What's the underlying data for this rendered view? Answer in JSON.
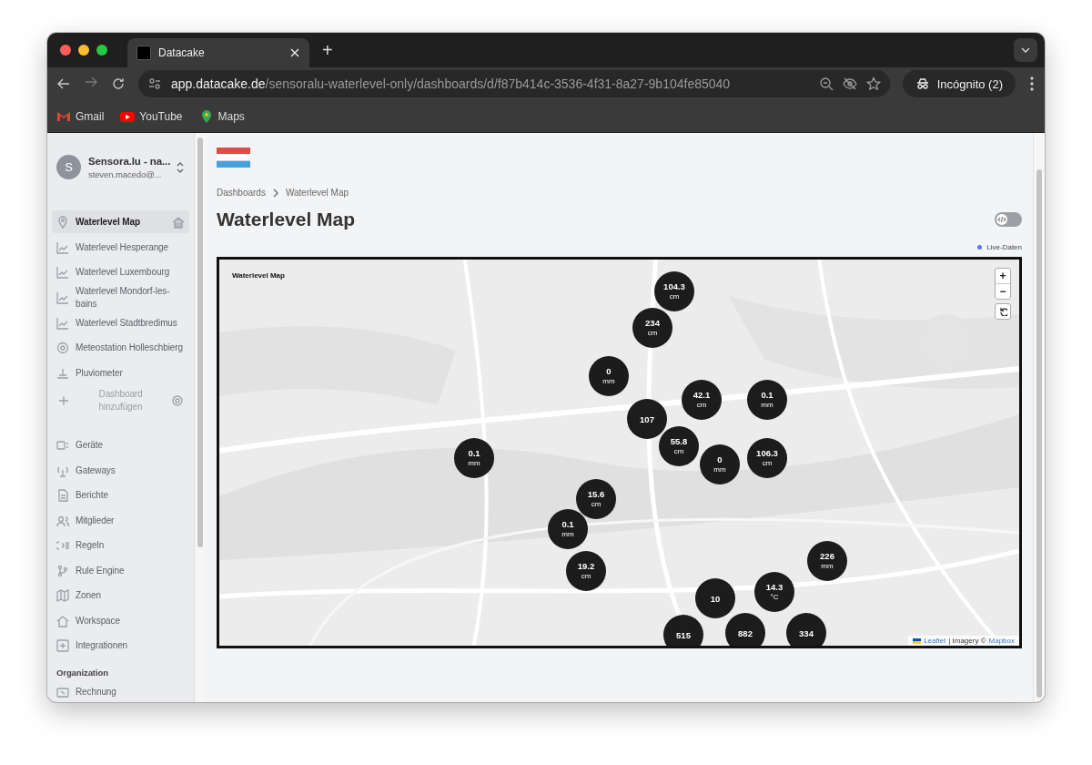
{
  "browser": {
    "tab_title": "Datacake",
    "new_tab": "+",
    "url_host": "app.datacake.de",
    "url_path": "/sensoralu-waterlevel-only/dashboards/d/f87b414c-3536-4f31-8a27-9b104fe85040",
    "profile": "Incógnito (2)",
    "bookmarks": [
      "Gmail",
      "YouTube",
      "Maps"
    ]
  },
  "sidebar": {
    "avatar": "S",
    "workspace": "Sensora.lu - na...",
    "email": "steven.macedo@...",
    "dashboards": [
      {
        "label": "Waterlevel Map",
        "selected": true,
        "home": true
      },
      {
        "label": "Waterlevel Hesperange",
        "selected": false,
        "home": false
      },
      {
        "label": "Waterlevel Luxembourg",
        "selected": false,
        "home": false
      },
      {
        "label": "Waterlevel Mondorf-les-bains",
        "selected": false,
        "home": false
      },
      {
        "label": "Waterlevel Stadtbredimus",
        "selected": false,
        "home": false
      },
      {
        "label": "Meteostation Holleschbierg",
        "selected": false,
        "home": false
      },
      {
        "label": "Pluviometer",
        "selected": false,
        "home": false
      }
    ],
    "add_dashboard": "Dashboard hinzufügen",
    "nav": [
      "Geräte",
      "Gateways",
      "Berichte",
      "Mitglieder",
      "Regeln",
      "Rule Engine",
      "Zonen",
      "Workspace",
      "Integrationen"
    ],
    "section": "Organization",
    "org_nav": [
      "Rechnung"
    ]
  },
  "breadcrumbs": [
    "Dashboards",
    "Waterlevel Map"
  ],
  "title": "Waterlevel Map",
  "edit_mode": false,
  "live_label": "Live-Daten",
  "map": {
    "title": "Waterlevel Map",
    "zoom_in": "+",
    "zoom_out": "−",
    "markers": [
      {
        "value": "104.3",
        "unit": "cm"
      },
      {
        "value": "234",
        "unit": "cm"
      },
      {
        "value": "0",
        "unit": "mm"
      },
      {
        "value": "42.1",
        "unit": "cm"
      },
      {
        "value": "0.1",
        "unit": "mm"
      },
      {
        "value": "107"
      },
      {
        "value": "55.8",
        "unit": "cm"
      },
      {
        "value": "0",
        "unit": "mm"
      },
      {
        "value": "106.3",
        "unit": "cm"
      },
      {
        "value": "0.1",
        "unit": "mm"
      },
      {
        "value": "15.6",
        "unit": "cm"
      },
      {
        "value": "0.1",
        "unit": "mm"
      },
      {
        "value": "19.2",
        "unit": "cm"
      },
      {
        "value": "226",
        "unit": "mm"
      },
      {
        "value": "14.3",
        "unit": "°C"
      },
      {
        "value": "10"
      },
      {
        "value": "515"
      },
      {
        "value": "882"
      },
      {
        "value": "334"
      }
    ],
    "attribution": {
      "leaflet": "Leaflet",
      "text": "| Imagery ©",
      "mapbox": "Mapbox"
    }
  }
}
